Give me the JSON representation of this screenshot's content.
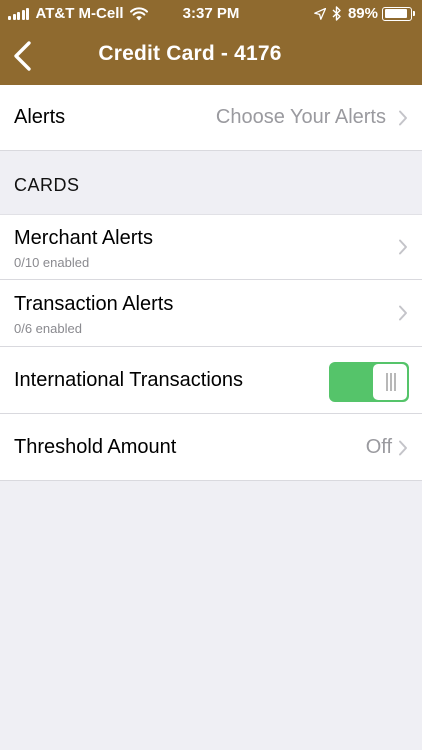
{
  "status_bar": {
    "carrier": "AT&T M-Cell",
    "time": "3:37 PM",
    "battery": "89%",
    "battery_level": 0.89
  },
  "nav": {
    "title": "Credit Card - 4176",
    "back_icon": "chevron-left-icon"
  },
  "alerts_row": {
    "label": "Alerts",
    "value": "Choose Your Alerts"
  },
  "cards_section": {
    "header": "CARDS",
    "merchant": {
      "label": "Merchant Alerts",
      "subtitle": "0/10 enabled"
    },
    "transaction": {
      "label": "Transaction Alerts",
      "subtitle": "0/6 enabled"
    },
    "international": {
      "label": "International Transactions",
      "enabled": true
    },
    "threshold": {
      "label": "Threshold Amount",
      "value": "Off"
    }
  },
  "colors": {
    "header_bg": "#8f6a2f",
    "toggle_on": "#55c46a",
    "background": "#efeff4"
  }
}
